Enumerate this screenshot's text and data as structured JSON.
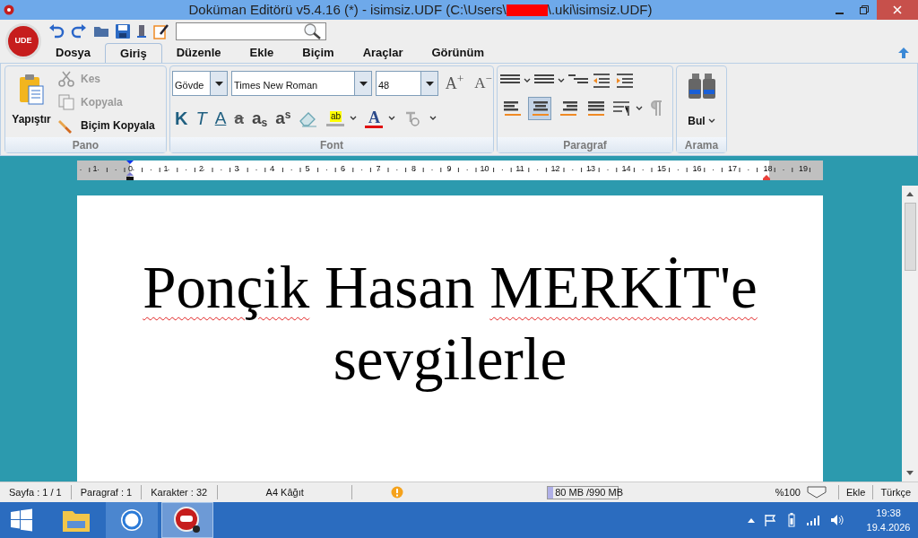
{
  "window": {
    "title_before": "Doküman Editörü v5.4.16 (*) - isimsiz.UDF (C:\\Users\\",
    "title_after": "\\.uki\\isimsiz.UDF)"
  },
  "app_logo": {
    "text": "UDE"
  },
  "tabs": [
    {
      "label": "Dosya",
      "selected": false
    },
    {
      "label": "Giriş",
      "selected": true
    },
    {
      "label": "Düzenle",
      "selected": false
    },
    {
      "label": "Ekle",
      "selected": false
    },
    {
      "label": "Biçim",
      "selected": false
    },
    {
      "label": "Araçlar",
      "selected": false
    },
    {
      "label": "Görünüm",
      "selected": false
    }
  ],
  "pano": {
    "label": "Pano",
    "paste": "Yapıştır",
    "items": [
      {
        "kind": "cut",
        "label": "Kes",
        "disabled": true
      },
      {
        "kind": "copy",
        "label": "Kopyala",
        "disabled": true
      },
      {
        "kind": "format",
        "label": "Biçim Kopyala",
        "disabled": false
      }
    ]
  },
  "font": {
    "label": "Font",
    "style": "Gövde",
    "family": "Times New Roman",
    "size": "48",
    "bold_glyph": "K",
    "italic_glyph": "T",
    "underline_glyph": "A",
    "strike_glyph": "a",
    "sub_glyph": "a",
    "sub_mark": "s",
    "sup_glyph": "a",
    "sup_mark": "s",
    "grow_glyph": "A",
    "grow_mark": "+",
    "shrink_glyph": "A",
    "shrink_mark": "−",
    "highlight_glyph": "ab",
    "color_glyph": "A"
  },
  "paragraph": {
    "label": "Paragraf",
    "align": [
      {
        "kind": "left",
        "selected": false
      },
      {
        "kind": "center",
        "selected": true
      },
      {
        "kind": "right",
        "selected": false
      },
      {
        "kind": "justify",
        "selected": false
      }
    ]
  },
  "search": {
    "label": "Arama",
    "button": "Bul"
  },
  "ruler": {
    "labels": [
      "1",
      "0",
      "1",
      "2",
      "3",
      "4",
      "5",
      "6",
      "7",
      "8",
      "9",
      "10",
      "11",
      "12",
      "13",
      "14",
      "15",
      "16",
      "17",
      "18",
      "19"
    ]
  },
  "document": {
    "lines": [
      [
        {
          "text": "Ponçik",
          "misspelled": true
        },
        {
          "text": "Hasan",
          "misspelled": false
        },
        {
          "text": "MERKİT'e",
          "misspelled": true
        }
      ],
      [
        {
          "text": "sevgilerle",
          "misspelled": false
        }
      ]
    ]
  },
  "status_bar": {
    "page": "Sayfa : 1 / 1",
    "paragraph": "Paragraf : 1",
    "characters": "Karakter : 32",
    "paper": "A4 Kâğıt",
    "memory": "80 MB /990 MB",
    "memory_level": {
      "level": 0.08
    },
    "zoom": "%100",
    "mode": "Ekle",
    "language": "Türkçe"
  },
  "taskbar": {
    "apps": [
      {
        "kind": "files",
        "selected": false
      },
      {
        "kind": "browser",
        "selected": false
      },
      {
        "kind": "editor",
        "selected": true
      }
    ],
    "time": "19:38",
    "date": "19.4.2026"
  }
}
